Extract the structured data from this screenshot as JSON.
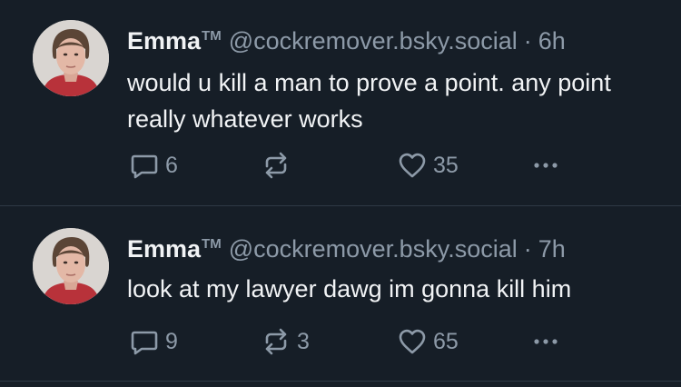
{
  "colors": {
    "background": "#161e27",
    "text": "#f1f3f5",
    "muted": "#8d9aa8",
    "divider": "#2e3945"
  },
  "posts": [
    {
      "author": {
        "name": "Emma",
        "trademark": "TM",
        "handle": "@cockremover.bsky.social",
        "avatar_icon": "avatar-photo"
      },
      "separator": "·",
      "time": "6h",
      "text": "would u kill a man to prove a point. any point really whatever works",
      "actions": {
        "reply": {
          "icon": "reply-bubble-icon",
          "count": "6"
        },
        "repost": {
          "icon": "repost-icon",
          "count": ""
        },
        "like": {
          "icon": "heart-icon",
          "count": "35"
        },
        "more": {
          "icon": "more-dots-icon"
        }
      }
    },
    {
      "author": {
        "name": "Emma",
        "trademark": "TM",
        "handle": "@cockremover.bsky.social",
        "avatar_icon": "avatar-photo"
      },
      "separator": "·",
      "time": "7h",
      "text": "look at my lawyer dawg im gonna kill him",
      "actions": {
        "reply": {
          "icon": "reply-bubble-icon",
          "count": "9"
        },
        "repost": {
          "icon": "repost-icon",
          "count": "3"
        },
        "like": {
          "icon": "heart-icon",
          "count": "65"
        },
        "more": {
          "icon": "more-dots-icon"
        }
      }
    }
  ]
}
